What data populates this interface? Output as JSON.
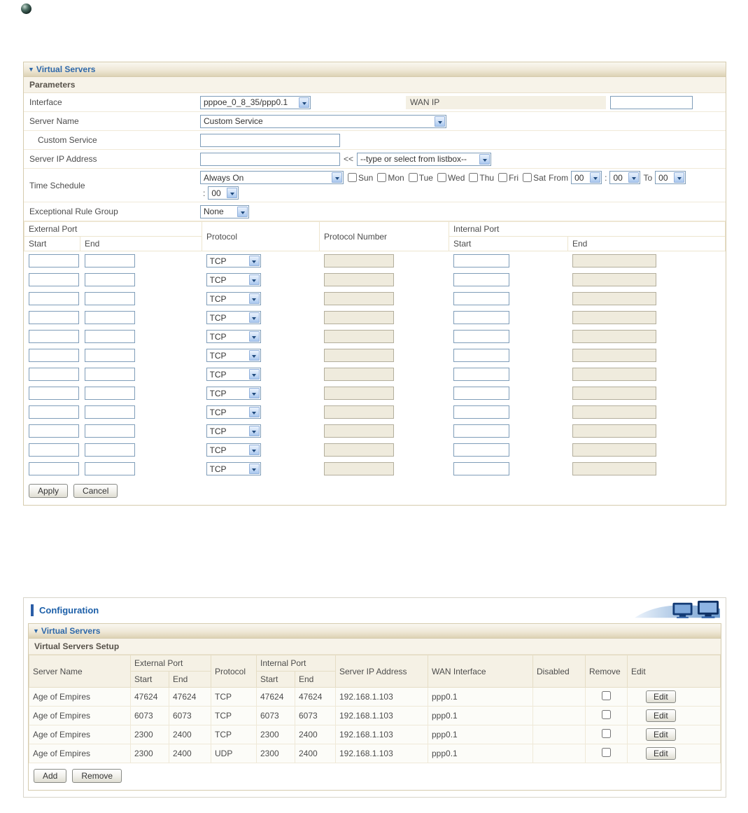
{
  "icons": {
    "bullet": "sphere-icon",
    "section_marker": "▼"
  },
  "colors": {
    "title_blue": "#1C5FA8",
    "panel_border": "#D5CBAE",
    "header_gradient_end": "#DDD2B4",
    "input_border": "#7F9DB9",
    "disabled_field_bg": "#EFEBDD"
  },
  "form_panel": {
    "title": "Virtual Servers",
    "params_header": "Parameters",
    "interface": {
      "label": "Interface",
      "value": "pppoe_0_8_35/ppp0.1"
    },
    "wan_ip": {
      "label": "WAN IP",
      "value": ""
    },
    "server_name": {
      "label": "Server Name",
      "value": "Custom Service"
    },
    "custom_service": {
      "label": "Custom Service",
      "value": ""
    },
    "server_ip": {
      "label": "Server IP Address",
      "value": "",
      "arrows": "<<",
      "listbox": "--type or select from listbox--"
    },
    "time_schedule": {
      "label": "Time Schedule",
      "value": "Always On",
      "days": [
        "Sun",
        "Mon",
        "Tue",
        "Wed",
        "Thu",
        "Fri",
        "Sat"
      ],
      "from_label": "From",
      "colon": ":",
      "to_label": "To",
      "from_hour": "00",
      "from_min": "00",
      "to_hour": "00",
      "to_min": "00"
    },
    "exceptional_rule": {
      "label": "Exceptional Rule Group",
      "value": "None"
    },
    "port_table": {
      "external_port": "External Port",
      "protocol": "Protocol",
      "protocol_number": "Protocol Number",
      "internal_port": "Internal Port",
      "start": "Start",
      "end": "End",
      "rows": [
        {
          "protocol": "TCP"
        },
        {
          "protocol": "TCP"
        },
        {
          "protocol": "TCP"
        },
        {
          "protocol": "TCP"
        },
        {
          "protocol": "TCP"
        },
        {
          "protocol": "TCP"
        },
        {
          "protocol": "TCP"
        },
        {
          "protocol": "TCP"
        },
        {
          "protocol": "TCP"
        },
        {
          "protocol": "TCP"
        },
        {
          "protocol": "TCP"
        },
        {
          "protocol": "TCP"
        }
      ]
    },
    "apply": "Apply",
    "cancel": "Cancel"
  },
  "config_panel": {
    "title": "Configuration",
    "subpanel_title": "Virtual Servers",
    "setup_header": "Virtual Servers Setup",
    "table": {
      "col_server_name": "Server Name",
      "col_external_port": "External Port",
      "col_protocol": "Protocol",
      "col_internal_port": "Internal Port",
      "col_server_ip": "Server IP Address",
      "col_wan_interface": "WAN Interface",
      "col_disabled": "Disabled",
      "col_remove": "Remove",
      "col_edit": "Edit",
      "col_start": "Start",
      "col_end": "End",
      "rows": [
        {
          "server_name": "Age of Empires",
          "ext_start": "47624",
          "ext_end": "47624",
          "protocol": "TCP",
          "int_start": "47624",
          "int_end": "47624",
          "server_ip": "192.168.1.103",
          "wan_interface": "ppp0.1",
          "disabled": "",
          "edit": "Edit"
        },
        {
          "server_name": "Age of Empires",
          "ext_start": "6073",
          "ext_end": "6073",
          "protocol": "TCP",
          "int_start": "6073",
          "int_end": "6073",
          "server_ip": "192.168.1.103",
          "wan_interface": "ppp0.1",
          "disabled": "",
          "edit": "Edit"
        },
        {
          "server_name": "Age of Empires",
          "ext_start": "2300",
          "ext_end": "2400",
          "protocol": "TCP",
          "int_start": "2300",
          "int_end": "2400",
          "server_ip": "192.168.1.103",
          "wan_interface": "ppp0.1",
          "disabled": "",
          "edit": "Edit"
        },
        {
          "server_name": "Age of Empires",
          "ext_start": "2300",
          "ext_end": "2400",
          "protocol": "UDP",
          "int_start": "2300",
          "int_end": "2400",
          "server_ip": "192.168.1.103",
          "wan_interface": "ppp0.1",
          "disabled": "",
          "edit": "Edit"
        }
      ]
    },
    "add_button": "Add",
    "remove_button": "Remove"
  }
}
